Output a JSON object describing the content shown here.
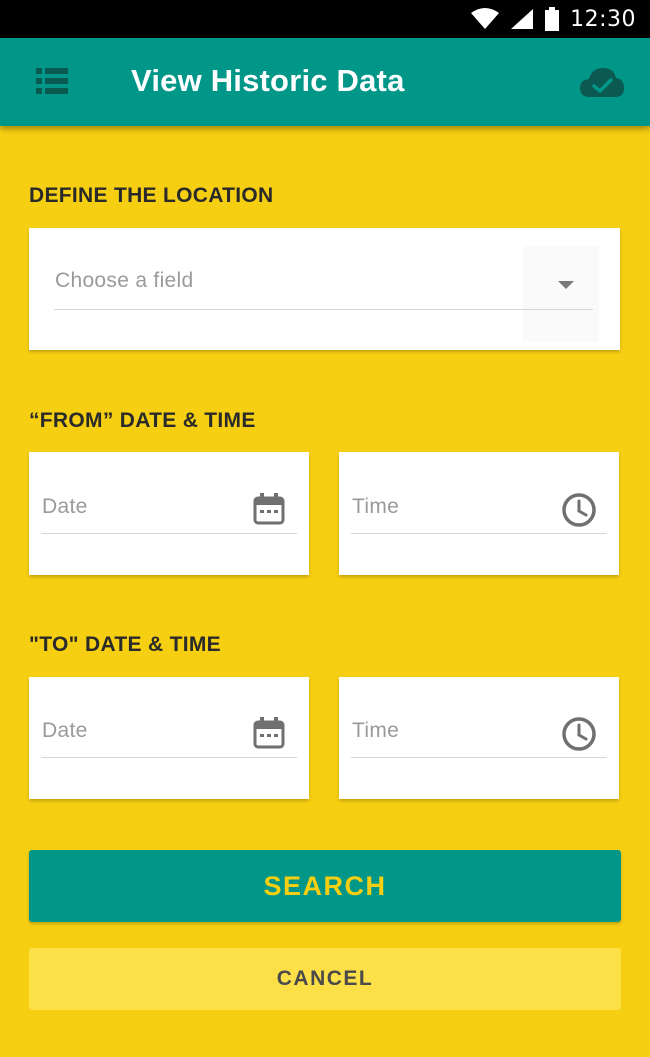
{
  "status_bar": {
    "time": "12:30",
    "icons": [
      "wifi-icon",
      "signal-icon",
      "battery-icon"
    ]
  },
  "app_bar": {
    "title": "View Historic Data",
    "left_icon": "menu-list-icon",
    "right_icon": "cloud-check-icon"
  },
  "location": {
    "heading": "DEFINE THE LOCATION",
    "field_placeholder": "Choose a field"
  },
  "from": {
    "heading": "“FROM” DATE & TIME",
    "date_placeholder": "Date",
    "time_placeholder": "Time"
  },
  "to": {
    "heading": "\"TO\" DATE & TIME",
    "date_placeholder": "Date",
    "time_placeholder": "Time"
  },
  "actions": {
    "search_label": "SEARCH",
    "cancel_label": "CANCEL"
  },
  "colors": {
    "background": "#F7CF12",
    "primary": "#009688",
    "status_bar": "#000000",
    "cancel_button": "#FDE047"
  }
}
